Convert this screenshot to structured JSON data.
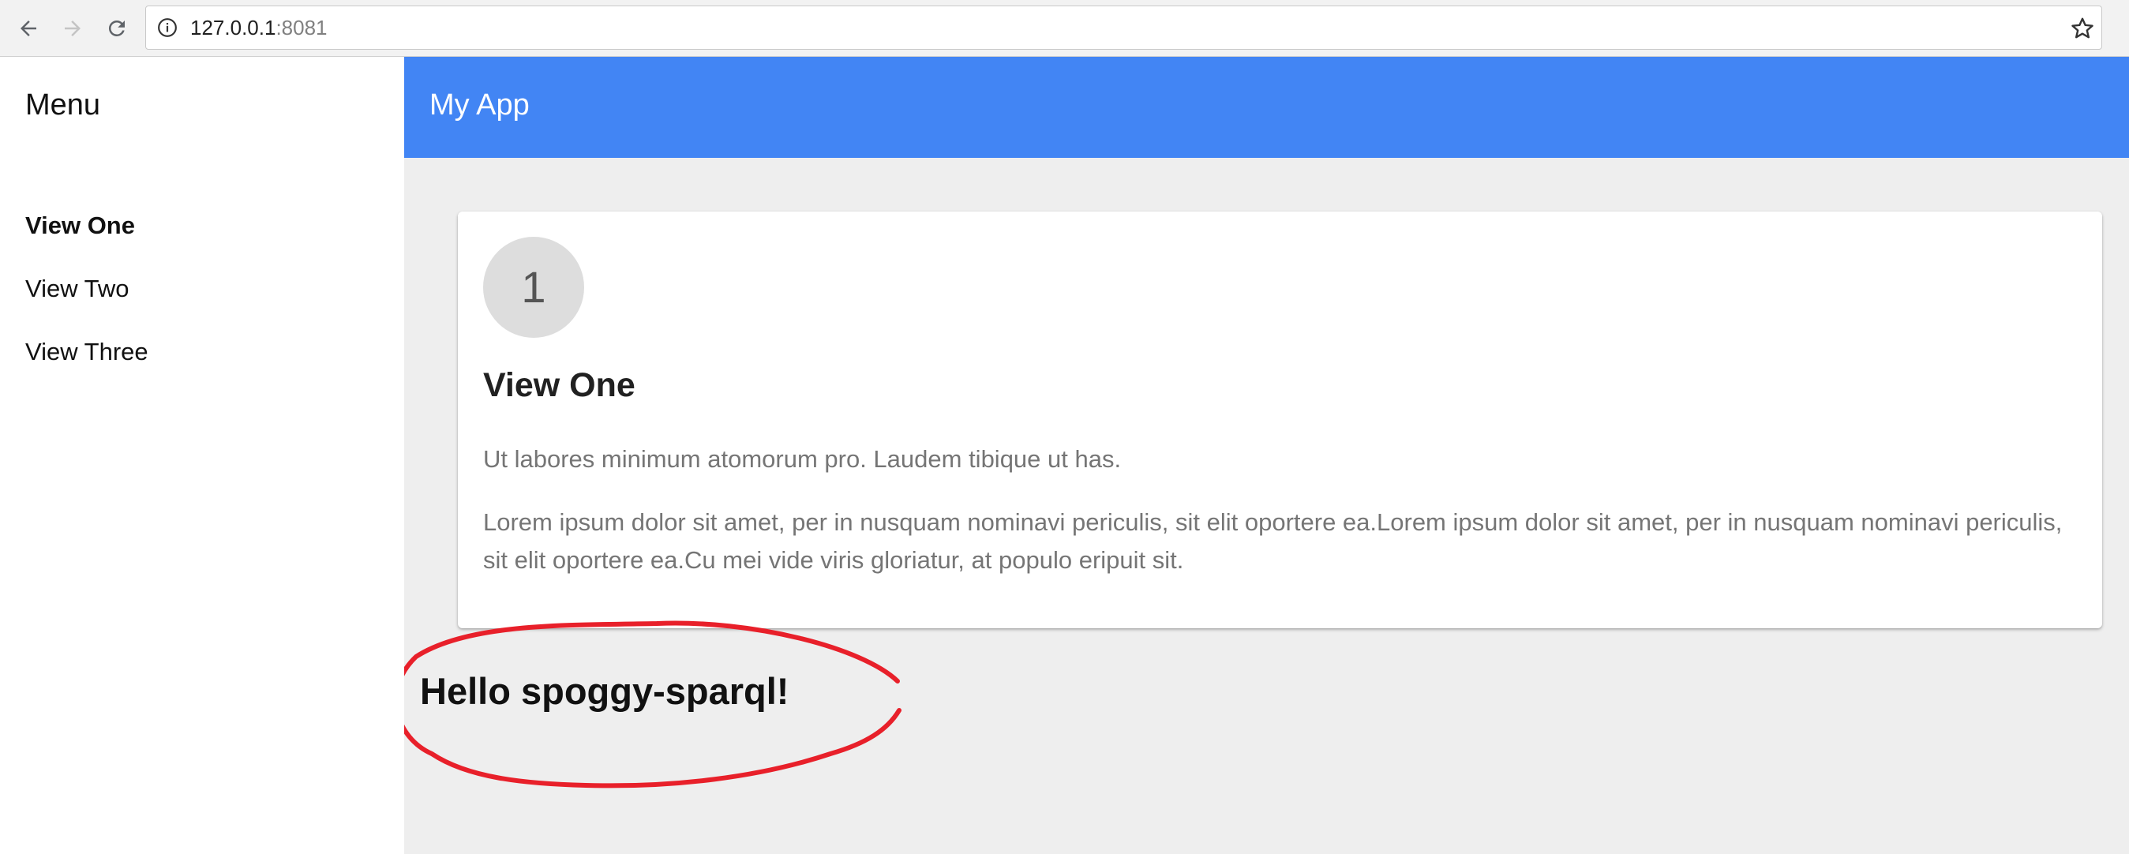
{
  "browser": {
    "url_host": "127.0.0.1",
    "url_port": ":8081",
    "back_icon": "arrow-left-icon",
    "forward_icon": "arrow-right-icon",
    "reload_icon": "reload-icon",
    "info_icon": "info-icon",
    "bookmark_icon": "star-icon"
  },
  "sidebar": {
    "title": "Menu",
    "items": [
      {
        "label": "View One",
        "active": true
      },
      {
        "label": "View Two",
        "active": false
      },
      {
        "label": "View Three",
        "active": false
      }
    ]
  },
  "header": {
    "title": "My App",
    "color": "#4285f4"
  },
  "card": {
    "badge": "1",
    "title": "View One",
    "paragraphs": [
      "Ut labores minimum atomorum pro. Laudem tibique ut has.",
      "Lorem ipsum dolor sit amet, per in nusquam nominavi periculis, sit elit oportere ea.Lorem ipsum dolor sit amet, per in nusquam nominavi periculis, sit elit oportere ea.Cu mei vide viris gloriatur, at populo eripuit sit."
    ]
  },
  "greeting": "Hello spoggy-sparql!",
  "annotation_color": "#e8202a"
}
